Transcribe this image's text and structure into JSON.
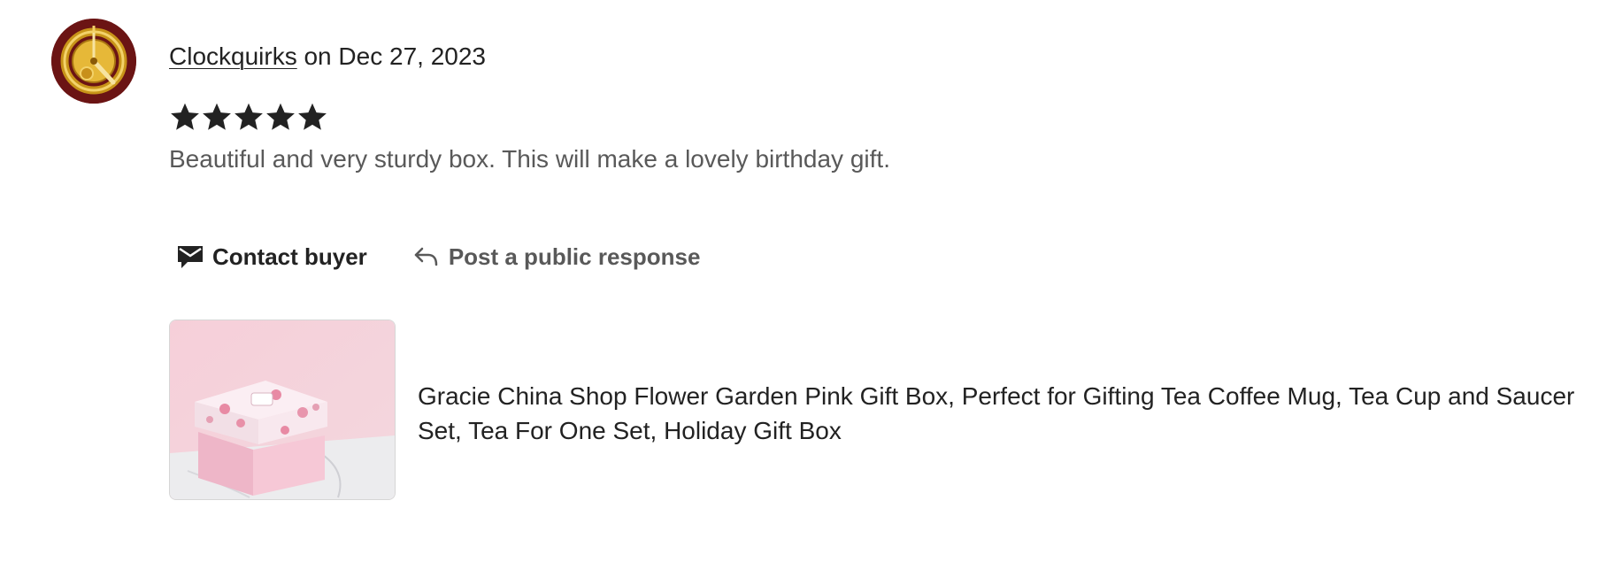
{
  "reviewer": {
    "name": "Clockquirks",
    "date_prefix": "on",
    "date": "Dec 27, 2023",
    "avatar_icon": "clock-logo-avatar"
  },
  "rating": {
    "stars": 5,
    "max": 5,
    "star_icon": "star-filled-icon",
    "star_color": "#222222"
  },
  "review": {
    "text": "Beautiful and very sturdy box. This will make a lovely birthday gift."
  },
  "actions": {
    "contact_label": "Contact buyer",
    "contact_icon": "envelope-icon",
    "respond_label": "Post a public response",
    "respond_icon": "reply-arrow-icon"
  },
  "listing": {
    "title": "Gracie China Shop Flower Garden Pink Gift Box, Perfect for Gifting Tea Coffee Mug, Tea Cup and Saucer Set, Tea For One Set, Holiday Gift Box",
    "image_icon": "pink-gift-box-photo"
  },
  "colors": {
    "text_primary": "#222222",
    "text_secondary": "#595959",
    "avatar_bg": "#6b1414",
    "gold": "#d4a52a"
  }
}
